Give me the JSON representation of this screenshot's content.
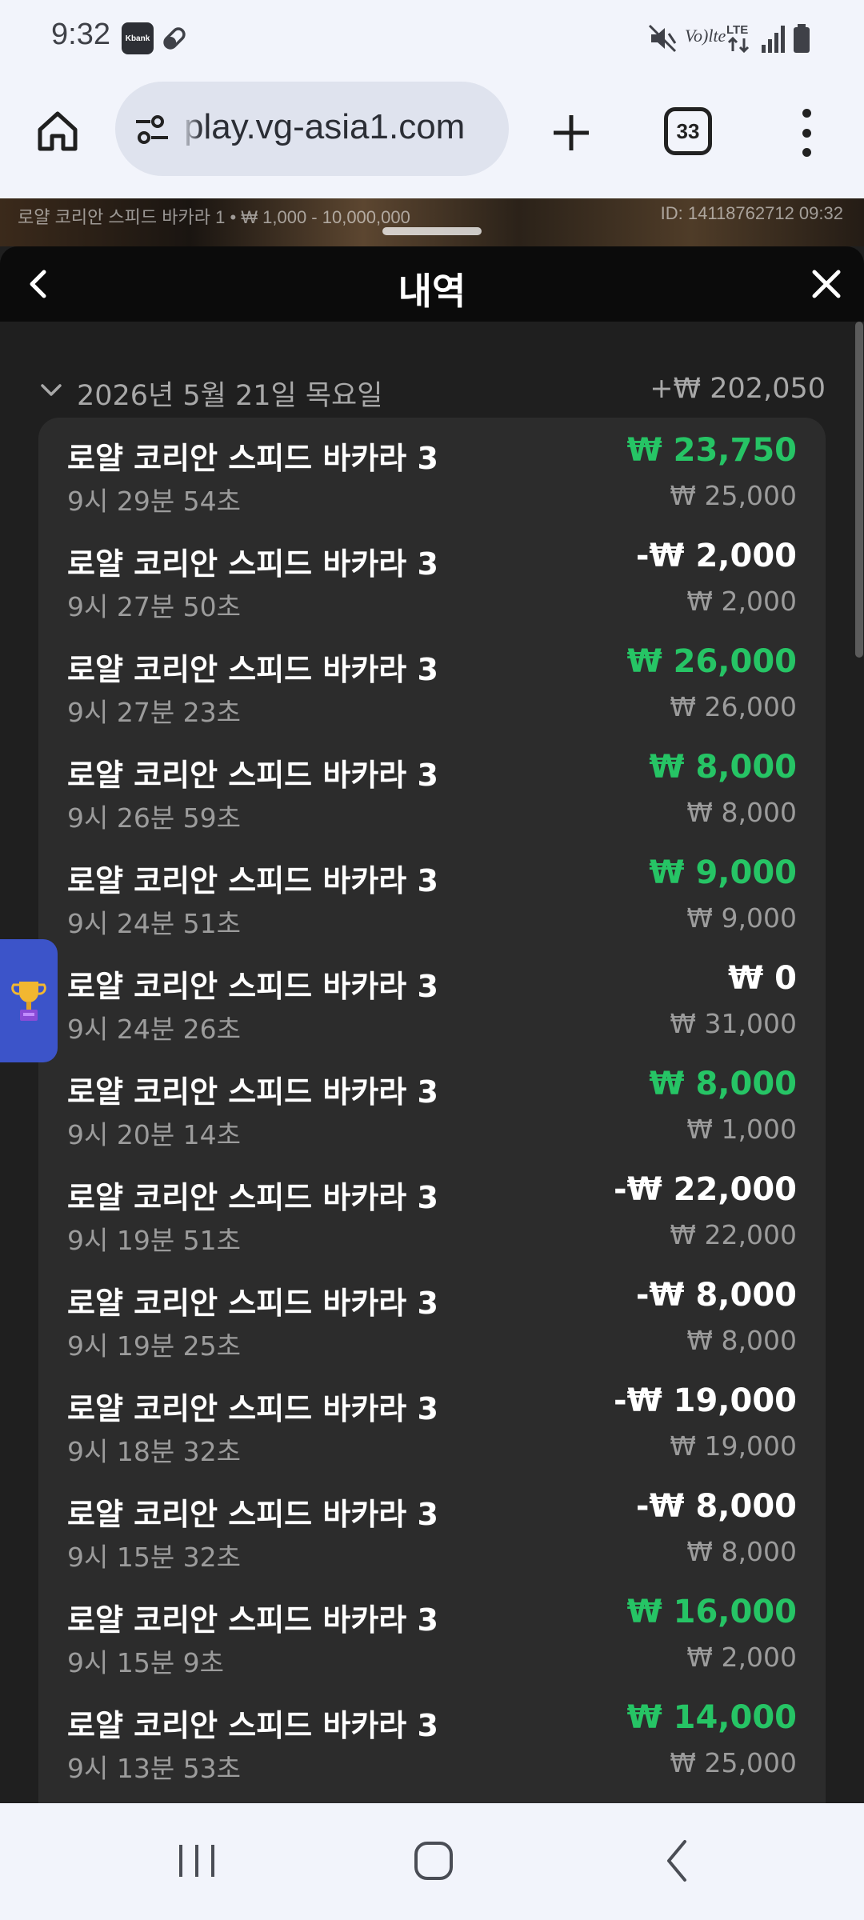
{
  "status_bar": {
    "time": "9:32",
    "app_badge": "Kbank",
    "network_label": "Vo)lte",
    "lte_label": "LTE",
    "icons": [
      "kbank-icon",
      "pill-icon",
      "mute-icon",
      "lte-icon",
      "signal-icon",
      "battery-icon"
    ]
  },
  "browser": {
    "url": "play.vg-asia1.com",
    "tab_count": "33",
    "icons": [
      "home-icon",
      "tune-icon",
      "plus-icon",
      "menu-icon"
    ]
  },
  "game_strip": {
    "info": "로얄 코리안 스피드 바카라 1 • ₩ 1,000 - 10,000,000",
    "id": "ID: 14118762712 09:32"
  },
  "panel": {
    "title": "내역",
    "icons": [
      "back-icon",
      "close-icon"
    ]
  },
  "history": {
    "day_label": "2026년 5월 21일 목요일",
    "day_total": "+₩ 202,050",
    "rows": [
      {
        "name": "로얄 코리안 스피드 바카라 3",
        "time": "9시 29분 54초",
        "result": "₩ 23,750",
        "bet": "₩ 25,000",
        "status": "win"
      },
      {
        "name": "로얄 코리안 스피드 바카라 3",
        "time": "9시 27분 50초",
        "result": "-₩ 2,000",
        "bet": "₩ 2,000",
        "status": "loss"
      },
      {
        "name": "로얄 코리안 스피드 바카라 3",
        "time": "9시 27분 23초",
        "result": "₩ 26,000",
        "bet": "₩ 26,000",
        "status": "win"
      },
      {
        "name": "로얄 코리안 스피드 바카라 3",
        "time": "9시 26분 59초",
        "result": "₩ 8,000",
        "bet": "₩ 8,000",
        "status": "win"
      },
      {
        "name": "로얄 코리안 스피드 바카라 3",
        "time": "9시 24분 51초",
        "result": "₩ 9,000",
        "bet": "₩ 9,000",
        "status": "win"
      },
      {
        "name": "로얄 코리안 스피드 바카라 3",
        "time": "9시 24분 26초",
        "result": "₩ 0",
        "bet": "₩ 31,000",
        "status": "even"
      },
      {
        "name": "로얄 코리안 스피드 바카라 3",
        "time": "9시 20분 14초",
        "result": "₩ 8,000",
        "bet": "₩ 1,000",
        "status": "win"
      },
      {
        "name": "로얄 코리안 스피드 바카라 3",
        "time": "9시 19분 51초",
        "result": "-₩ 22,000",
        "bet": "₩ 22,000",
        "status": "loss"
      },
      {
        "name": "로얄 코리안 스피드 바카라 3",
        "time": "9시 19분 25초",
        "result": "-₩ 8,000",
        "bet": "₩ 8,000",
        "status": "loss"
      },
      {
        "name": "로얄 코리안 스피드 바카라 3",
        "time": "9시 18분 32초",
        "result": "-₩ 19,000",
        "bet": "₩ 19,000",
        "status": "loss"
      },
      {
        "name": "로얄 코리안 스피드 바카라 3",
        "time": "9시 15분 32초",
        "result": "-₩ 8,000",
        "bet": "₩ 8,000",
        "status": "loss"
      },
      {
        "name": "로얄 코리안 스피드 바카라 3",
        "time": "9시 15분 9초",
        "result": "₩ 16,000",
        "bet": "₩ 2,000",
        "status": "win"
      },
      {
        "name": "로얄 코리안 스피드 바카라 3",
        "time": "9시 13분 53초",
        "result": "₩ 14,000",
        "bet": "₩ 25,000",
        "status": "win"
      }
    ]
  },
  "side_tab": {
    "icon": "trophy-icon"
  },
  "nav_bar": {
    "icons": [
      "recents-icon",
      "home-circle-icon",
      "back-chevron-icon"
    ]
  },
  "colors": {
    "win": "#26c465",
    "neutral": "#ffffff",
    "muted": "#9c9c9c",
    "card": "#2c2c2c",
    "panel": "#1f1f1f",
    "side_tab": "#3c54c9"
  }
}
